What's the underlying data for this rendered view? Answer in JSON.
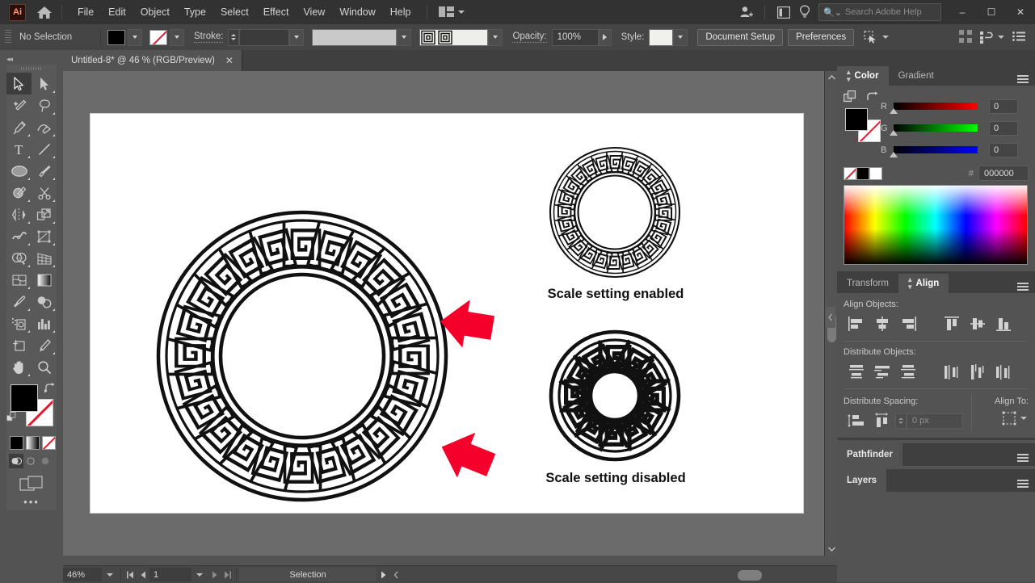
{
  "app": {
    "name": "Ai",
    "title_tab": "Untitled-8* @ 46 % (RGB/Preview)"
  },
  "menubar": {
    "items": [
      "File",
      "Edit",
      "Object",
      "Type",
      "Select",
      "Effect",
      "View",
      "Window",
      "Help"
    ],
    "search_placeholder": "Search Adobe Help",
    "window_buttons": {
      "minimize": "–",
      "maximize": "☐",
      "close": "✕"
    }
  },
  "controlbar": {
    "selection_label": "No Selection",
    "stroke_label": "Stroke:",
    "opacity_label": "Opacity:",
    "opacity_value": "100%",
    "style_label": "Style:",
    "document_setup": "Document Setup",
    "preferences": "Preferences"
  },
  "toolbar": {
    "tools": [
      "selection-tool",
      "direct-selection-tool",
      "magic-wand-tool",
      "lasso-tool",
      "pen-tool",
      "curvature-tool",
      "type-tool",
      "line-segment-tool",
      "ellipse-tool",
      "paintbrush-tool",
      "shaper-tool",
      "scissors-tool",
      "rotate-tool",
      "scale-tool",
      "width-tool",
      "free-transform-tool",
      "shape-builder-tool",
      "perspective-grid-tool",
      "mesh-tool",
      "gradient-tool",
      "eyedropper-tool",
      "blend-tool",
      "symbol-sprayer-tool",
      "column-graph-tool",
      "artboard-tool",
      "slice-tool",
      "hand-tool",
      "zoom-tool"
    ],
    "fill_color": "#000000",
    "stroke_color": "none",
    "color_modes": [
      "color",
      "gradient",
      "none"
    ],
    "screen_modes": [
      "normal-screen-mode",
      "full-screen-menu-bar",
      "full-screen"
    ],
    "more_label": "•••"
  },
  "color_panel": {
    "tabs": [
      {
        "label": "Color",
        "active": true
      },
      {
        "label": "Gradient",
        "active": false
      }
    ],
    "channels": [
      {
        "label": "R",
        "value": "0"
      },
      {
        "label": "G",
        "value": "0"
      },
      {
        "label": "B",
        "value": "0"
      }
    ],
    "hex_symbol": "#",
    "hex_value": "000000"
  },
  "align_panel": {
    "tabs": [
      {
        "label": "Transform",
        "active": false
      },
      {
        "label": "Align",
        "active": true
      }
    ],
    "align_objects_label": "Align Objects:",
    "align_objects_buttons": [
      "horizontal-align-left",
      "horizontal-align-center",
      "horizontal-align-right",
      "vertical-align-top",
      "vertical-align-center",
      "vertical-align-bottom"
    ],
    "distribute_objects_label": "Distribute Objects:",
    "distribute_objects_buttons": [
      "vertical-distribute-top",
      "vertical-distribute-center",
      "vertical-distribute-bottom",
      "horizontal-distribute-left",
      "horizontal-distribute-center",
      "horizontal-distribute-right"
    ],
    "distribute_spacing_label": "Distribute Spacing:",
    "distribute_spacing_buttons": [
      "vertical-distribute-space",
      "horizontal-distribute-space"
    ],
    "spacing_value": "0 px",
    "align_to_label": "Align To:"
  },
  "collapsed_panels": [
    {
      "label": "Pathfinder"
    },
    {
      "label": "Layers"
    }
  ],
  "statusbar": {
    "zoom": "46%",
    "page": "1",
    "status": "Selection"
  },
  "canvas": {
    "items": [
      {
        "name": "greek-key-ring-large",
        "caption": "",
        "segments": 24,
        "stroke_weight": 2.2,
        "outer_r": 176,
        "inner_r": 108
      },
      {
        "name": "greek-key-ring-scaled",
        "caption": "Scale setting enabled",
        "segments": 24,
        "stroke_weight": 1.0,
        "outer_r": 79,
        "inner_r": 49
      },
      {
        "name": "greek-key-ring-unscaled",
        "caption": "Scale setting disabled",
        "segments": 12,
        "stroke_weight": 2.2,
        "outer_r": 79,
        "inner_r": 33
      }
    ],
    "arrows": [
      {
        "name": "red-arrow-top",
        "color": "#F5002B"
      },
      {
        "name": "red-arrow-bottom",
        "color": "#F5002B"
      }
    ],
    "caption_enabled": "Scale setting enabled",
    "caption_disabled": "Scale setting disabled",
    "accent_red": "#F5002B"
  }
}
